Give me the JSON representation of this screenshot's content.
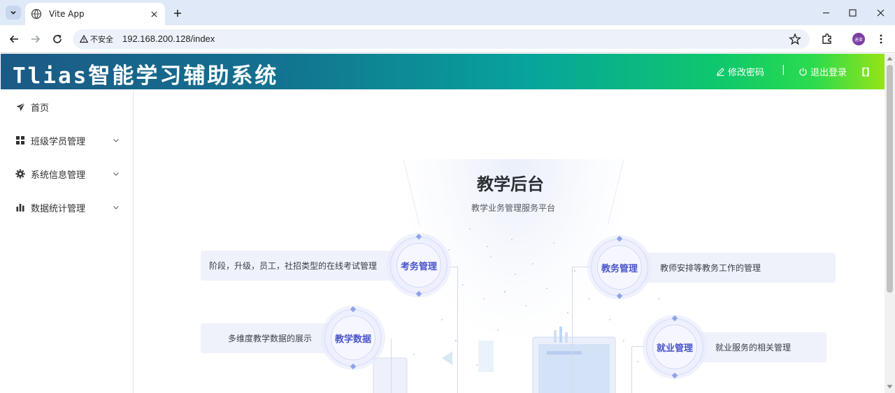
{
  "browser": {
    "tab_title": "Vite App",
    "security_label": "不安全",
    "url": "192.168.200.128/index",
    "profile_initials": "迪亚"
  },
  "header": {
    "app_title": "Tlias智能学习辅助系统",
    "change_password": "修改密码",
    "separator": "|",
    "logout": "退出登录",
    "bracket": "【】"
  },
  "sidebar": {
    "items": [
      {
        "label": "首页",
        "icon": "paper-plane-icon",
        "expandable": false
      },
      {
        "label": "班级学员管理",
        "icon": "grid-icon",
        "expandable": true
      },
      {
        "label": "系统信息管理",
        "icon": "gear-icon",
        "expandable": true
      },
      {
        "label": "数据统计管理",
        "icon": "bar-chart-icon",
        "expandable": true
      }
    ]
  },
  "main": {
    "title": "教学后台",
    "subtitle": "教学业务管理服务平台",
    "modules": [
      {
        "name": "考务管理",
        "description": "阶段，升级，员工，社招类型的在线考试管理"
      },
      {
        "name": "教务管理",
        "description": "教师安排等教务工作的管理"
      },
      {
        "name": "教学数据",
        "description": "多维度教学数据的展示"
      },
      {
        "name": "就业管理",
        "description": "就业服务的相关管理"
      }
    ]
  },
  "colors": {
    "accent": "#4a54c9",
    "header_start": "#1c5a86",
    "header_end": "#96e414"
  }
}
